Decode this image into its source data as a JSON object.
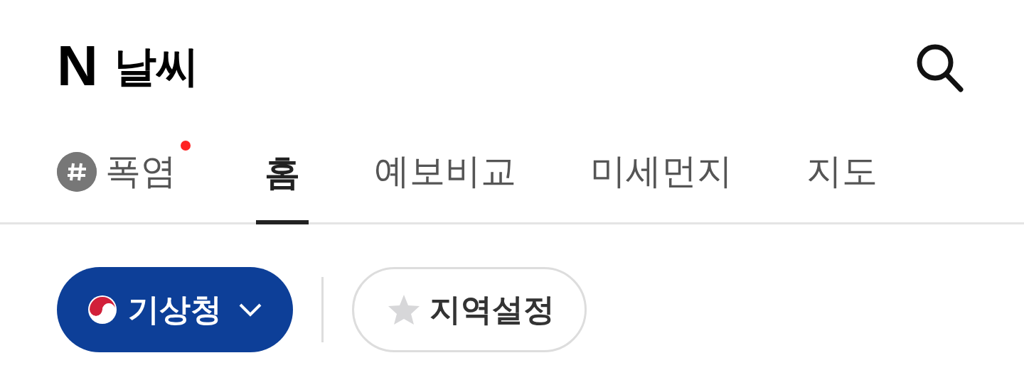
{
  "header": {
    "logo_mark": "N",
    "title": "날씨"
  },
  "tabs": [
    {
      "label": "폭염",
      "kind": "hashtag",
      "selected": false,
      "new": true
    },
    {
      "label": "홈",
      "kind": "plain",
      "selected": true,
      "new": false
    },
    {
      "label": "예보비교",
      "kind": "plain",
      "selected": false,
      "new": false
    },
    {
      "label": "미세먼지",
      "kind": "plain",
      "selected": false,
      "new": false
    },
    {
      "label": "지도",
      "kind": "plain",
      "selected": false,
      "new": false
    }
  ],
  "source_button": {
    "label": "기상청"
  },
  "region_button": {
    "label": "지역설정"
  }
}
